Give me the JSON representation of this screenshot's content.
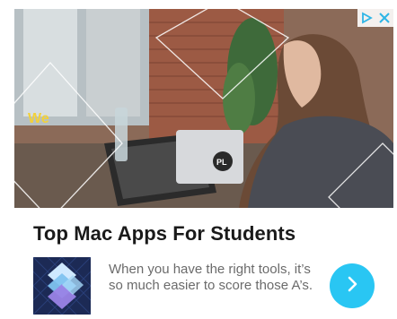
{
  "ad": {
    "headline": "Top Mac Apps For Students",
    "description": "When you have the right tools, it’s so much easier to score those A’s.",
    "hero_image_alt": "",
    "app_icon_name": "layered-diamonds-app-icon",
    "cta_icon": "chevron-right-icon",
    "adchoices_icons": [
      "adchoices-triangle-icon",
      "close-x-icon"
    ]
  },
  "colors": {
    "accent": "#29c6f3",
    "headline": "#1a1a1a",
    "body_text": "#6b6b6b",
    "icon_bg": "#1c2a55",
    "adchoices": "#2fb5e6"
  }
}
